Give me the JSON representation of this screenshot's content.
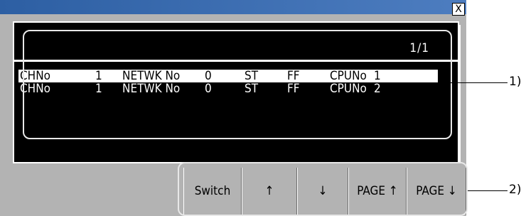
{
  "dialog": {
    "close_label": "X",
    "page_indicator": "1/1",
    "rows": [
      {
        "chno_label": "CHNo",
        "chno": "1",
        "netwk_label": "NETWK No",
        "netwk": "0",
        "st_label": "ST",
        "st": "FF",
        "cpuno_label": "CPUNo",
        "cpuno": "1",
        "selected": true
      },
      {
        "chno_label": "CHNo",
        "chno": "1",
        "netwk_label": "NETWK No",
        "netwk": "0",
        "st_label": "ST",
        "st": "FF",
        "cpuno_label": "CPUNo",
        "cpuno": "2",
        "selected": false
      }
    ],
    "buttons": {
      "switch": "Switch",
      "up": "↑",
      "down": "↓",
      "page_up": "PAGE ↑",
      "page_down": "PAGE ↓"
    }
  },
  "callouts": {
    "list": "1)",
    "buttons": "2)"
  }
}
